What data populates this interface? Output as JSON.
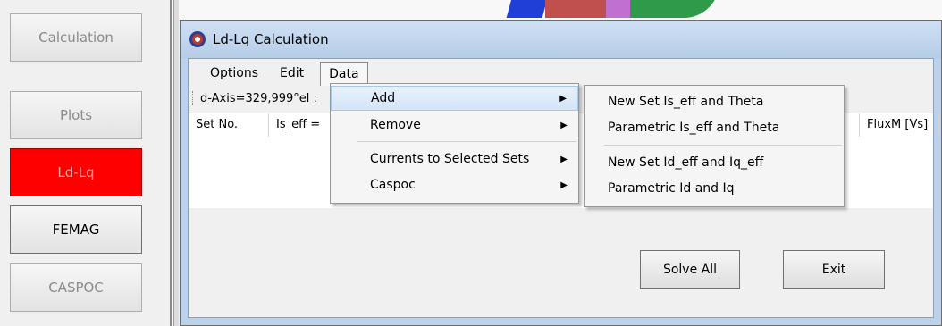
{
  "sidebar": {
    "buttons": [
      {
        "label": "Calculation"
      },
      {
        "label": "Plots"
      },
      {
        "label": "Ld-Lq"
      },
      {
        "label": "FEMAG"
      },
      {
        "label": "CASPOC"
      }
    ]
  },
  "window": {
    "title": "Ld-Lq Calculation",
    "menu": [
      "Options",
      "Edit",
      "Data"
    ],
    "axis_text": "d-Axis=329,999°el :",
    "columns": [
      "Set No.",
      "Is_eff =",
      "FluxM [Vs]"
    ],
    "buttons": {
      "solve": "Solve All",
      "exit": "Exit"
    }
  },
  "data_menu": {
    "items": [
      {
        "label": "Add"
      },
      {
        "label": "Remove"
      },
      {
        "label": "Currents to Selected Sets"
      },
      {
        "label": "Caspoc"
      }
    ]
  },
  "add_submenu": {
    "items": [
      {
        "label": "New Set Is_eff and Theta"
      },
      {
        "label": "Parametric Is_eff and Theta"
      },
      {
        "label": "New Set Id_eff and Iq_eff"
      },
      {
        "label": "Parametric Id and Iq"
      }
    ]
  },
  "colors": {
    "active_button": "#ff0000",
    "titlebar": "#bcd2ea",
    "menu_highlight": "#d4e5f8"
  }
}
